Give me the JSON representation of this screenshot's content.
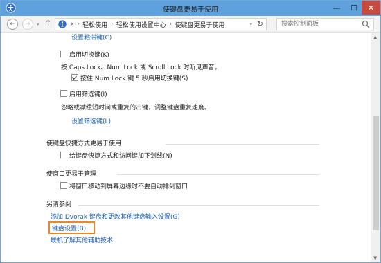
{
  "window": {
    "title": "使键盘更易于使用",
    "min_symbol": "—",
    "max_symbol": "☐",
    "close_symbol": "✕"
  },
  "nav": {
    "back_symbol": "←",
    "forward_symbol": "→",
    "dropdown_symbol": "▾",
    "up_symbol": "↑",
    "address_prefix": "«",
    "breadcrumb": [
      "轻松使用",
      "轻松使用设置中心",
      "使键盘更易于使用"
    ],
    "breadcrumb_sep": "›",
    "refresh_symbol": "↻",
    "search_placeholder": "搜索控制面板"
  },
  "content": {
    "sticky_keys_link": "设置粘滞键(C)",
    "toggle_keys": {
      "label": "启用切换键(K)",
      "checked": false,
      "description": "按 Caps Lock、Num Lock 或 Scroll Lock 时听见声音。",
      "sub_option_label": "按住 Num Lock 键 5 秒启用切换键(S)",
      "sub_option_checked": true
    },
    "filter_keys": {
      "label": "启用筛选键(I)",
      "checked": false,
      "description": "忽略或减缓短时间或重复的击键，调整键盘重复速度。",
      "link": "设置筛选键(L)"
    },
    "shortcut_section": {
      "heading": "使键盘快捷方式更易于使用",
      "option_label": "给键盘快捷方式和访问键加下划线(N)",
      "checked": false
    },
    "window_section": {
      "heading": "使窗口更易于管理",
      "option_label": "将窗口移动到屏幕边缘时不要自动排列窗口",
      "checked": false
    },
    "see_also": {
      "heading": "另请参阅",
      "links": [
        "添加 Dvorak 键盘和更改其他键盘输入设置(G)",
        "键盘设置(B)",
        "联机了解其他辅助技术"
      ]
    }
  },
  "colors": {
    "titlebar": "#5ea1dd",
    "link": "#1a5fb4",
    "highlight_box": "#e58a2c",
    "close_button": "#c74a3e"
  }
}
